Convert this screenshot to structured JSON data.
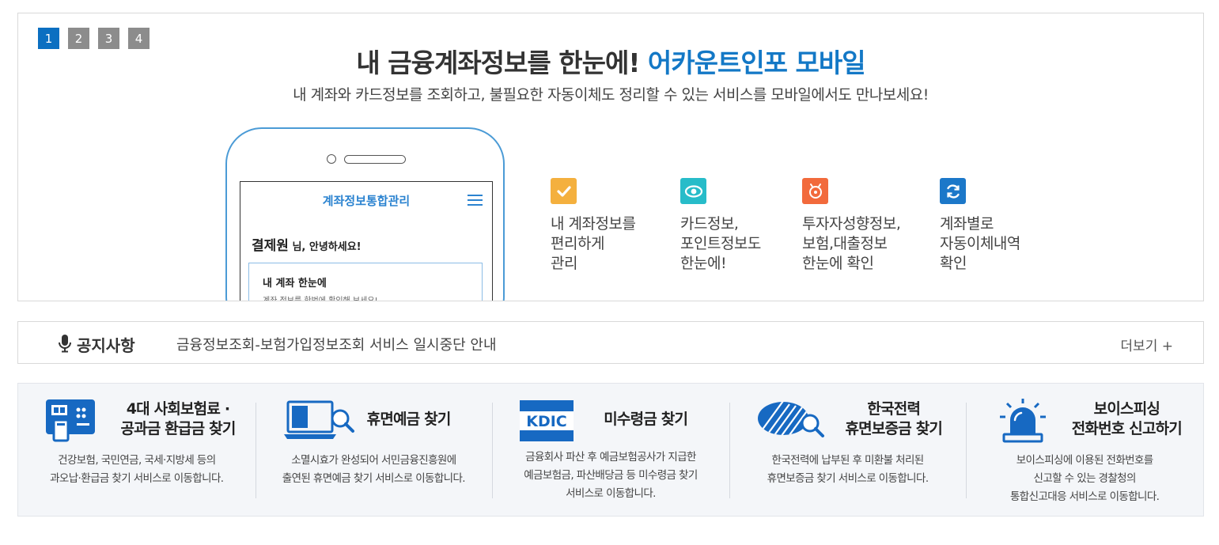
{
  "banner": {
    "pages": [
      "1",
      "2",
      "3",
      "4"
    ],
    "active_page": "1",
    "headline_main": "내 금융계좌정보를 한눈에! ",
    "headline_accent": "어카운트인포 모바일",
    "subline": "내 계좌와 카드정보를 조회하고, 불필요한 자동이체도 정리할 수 있는 서비스를 모바일에서도 만나보세요!",
    "phone": {
      "screen_title": "계좌정보통합관리",
      "user_name": "결제원",
      "greeting_suffix": " 님, 안녕하세요!",
      "card_title": "내 계좌 한눈에",
      "card_desc": "계좌 정보를 한번에 확인해 보세요!"
    },
    "features": [
      {
        "icon": "check-icon",
        "color": "#f4b03e",
        "text": "내 계좌정보를\n편리하게\n관리"
      },
      {
        "icon": "eye-icon",
        "color": "#27bcc9",
        "text": "카드정보,\n포인트정보도\n한눈에!"
      },
      {
        "icon": "piggybank-icon",
        "color": "#f26a3c",
        "text": "투자자성향정보,\n보험,대출정보\n한눈에 확인"
      },
      {
        "icon": "refresh-icon",
        "color": "#1c78c9",
        "text": "계좌별로\n자동이체내역\n확인"
      }
    ]
  },
  "notice": {
    "label": "공지사항",
    "text": "금융정보조회-보험가입정보조회 서비스 일시중단 안내",
    "more": "더보기 +"
  },
  "services": [
    {
      "icon": "atm-icon",
      "title": "4대 사회보험료 ·\n공과금 환급금 찾기",
      "desc": "건강보험, 국민연금, 국세·지방세 등의\n과오납·환급금 찾기 서비스로 이동합니다."
    },
    {
      "icon": "laptop-search-icon",
      "title": "휴면예금 찾기",
      "desc": "소멸시효가 완성되어 서민금융진흥원에\n출연된 휴면예금 찾기 서비스로 이동합니다."
    },
    {
      "icon": "kdic-logo",
      "logo_text": "KDIC",
      "title": "미수령금 찾기",
      "desc": "금융회사 파산 후 예금보험공사가 지급한\n예금보험금, 파산배당금 등 미수령금 찾기\n서비스로 이동합니다."
    },
    {
      "icon": "kepco-search-icon",
      "title": "한국전력\n휴면보증금 찾기",
      "desc": "한국전력에 납부된 후 미환불 처리된\n휴면보증금 찾기 서비스로 이동합니다."
    },
    {
      "icon": "siren-icon",
      "title": "보이스피싱\n전화번호 신고하기",
      "desc": "보이스피싱에 이용된 전화번호를\n신고할 수 있는 경찰청의\n통합신고대응 서비스로 이동합니다."
    }
  ]
}
